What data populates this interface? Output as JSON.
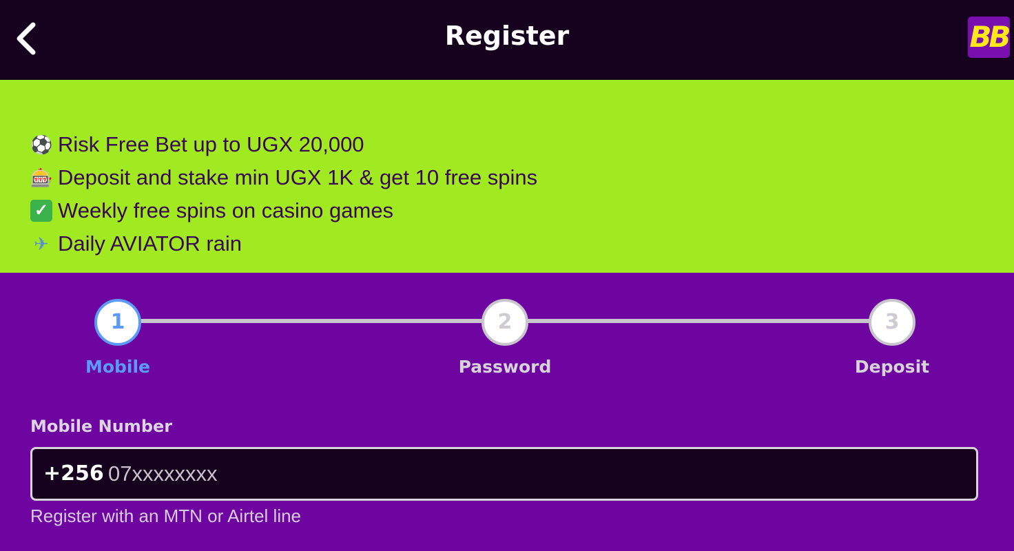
{
  "header": {
    "title": "Register",
    "back_icon": "chevron-left-icon",
    "logo_text": "BB"
  },
  "promo": {
    "items": [
      {
        "icon": "⚽",
        "icon_name": "soccer-ball-icon",
        "text": "Risk Free Bet up to UGX 20,000"
      },
      {
        "icon": "🎰",
        "icon_name": "slot-machine-icon",
        "text": "Deposit and stake min UGX 1K & get 10 free spins"
      },
      {
        "icon": "✓",
        "icon_name": "check-mark-icon",
        "text": "Weekly free spins on casino games"
      },
      {
        "icon": "✈",
        "icon_name": "airplane-icon",
        "text": "Daily AVIATOR rain"
      }
    ]
  },
  "steps": [
    {
      "number": "1",
      "label": "Mobile",
      "active": true
    },
    {
      "number": "2",
      "label": "Password",
      "active": false
    },
    {
      "number": "3",
      "label": "Deposit",
      "active": false
    }
  ],
  "form": {
    "mobile_label": "Mobile Number",
    "prefix": "+256",
    "placeholder": "07xxxxxxxx",
    "value": "",
    "helper": "Register with an MTN or Airtel line"
  },
  "colors": {
    "header_bg": "#16011e",
    "promo_bg": "#a1ea21",
    "main_bg": "#6e05a1",
    "active_step": "#5b9bf7",
    "logo_yellow": "#ffe81a"
  }
}
